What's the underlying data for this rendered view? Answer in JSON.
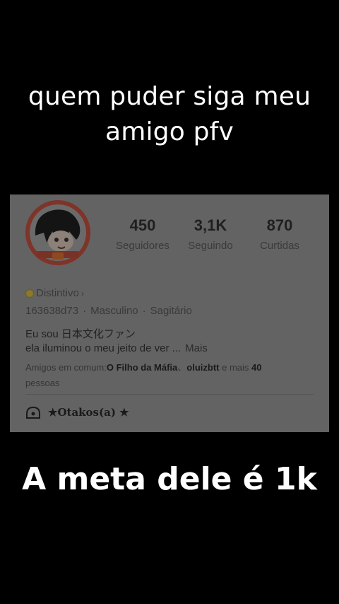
{
  "captions": {
    "top_line1": "quem puder siga meu",
    "top_line2": "amigo pfv",
    "bottom": "A meta dele é 1k"
  },
  "profile": {
    "avatar_icon": "avatar-image",
    "stats": [
      {
        "value": "450",
        "label": "Seguidores"
      },
      {
        "value": "3,1K",
        "label": "Seguindo"
      },
      {
        "value": "870",
        "label": "Curtidas"
      }
    ],
    "badge": {
      "label": "Distintivo",
      "chevron": "›"
    },
    "meta": {
      "id": "163638d73",
      "gender": "Masculino",
      "sign": "Sagitário",
      "separator": "·"
    },
    "bio": {
      "line1": "Eu sou 日本文化ファン",
      "line2": "ela iluminou o meu jeito de ver ...",
      "more": "Mais"
    },
    "mutual": {
      "prefix": "Amigos em comum:",
      "friend1": "O Filho da Máfia",
      "joiner": "、",
      "friend2": "oluizbtt",
      "middle": " e mais ",
      "count": "40",
      "suffix": "pessoas"
    },
    "group": {
      "icon": "group-icon",
      "name": "★Otakos(a) ★"
    }
  },
  "colors": {
    "background": "#000000",
    "card": "#636363",
    "caption_text": "#ffffff"
  }
}
